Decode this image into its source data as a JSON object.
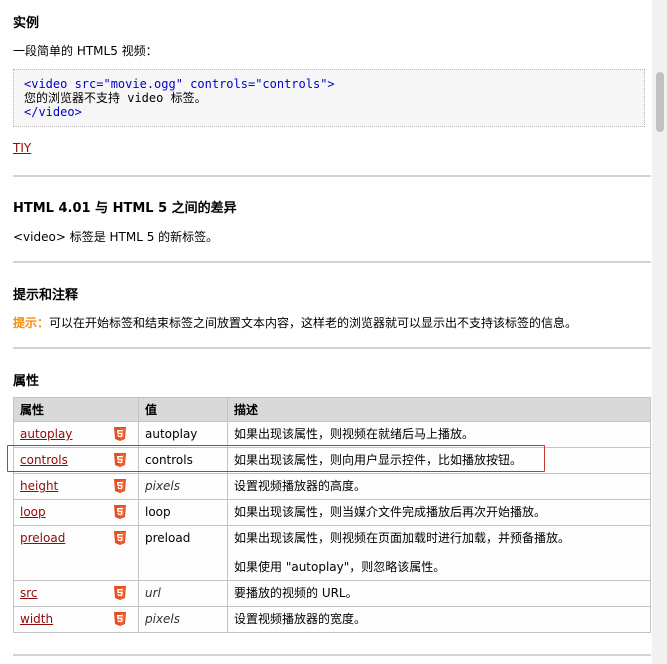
{
  "example": {
    "heading": "实例",
    "intro": "一段简单的 HTML5 视频：",
    "code": {
      "line1": "<video src=\"movie.ogg\" controls=\"controls\">",
      "line2": "您的浏览器不支持 video 标签。",
      "line3": "</video>"
    },
    "tiy_link": "TIY"
  },
  "diff": {
    "heading": "HTML 4.01 与 HTML 5 之间的差异",
    "text": "<video> 标签是 HTML 5 的新标签。"
  },
  "tips": {
    "heading": "提示和注释",
    "label": "提示：",
    "text": "可以在开始标签和结束标签之间放置文本内容，这样老的浏览器就可以显示出不支持该标签的信息。"
  },
  "attributes": {
    "heading": "属性",
    "columns": [
      "属性",
      "值",
      "描述"
    ],
    "rows": [
      {
        "name": "autoplay",
        "value": "autoplay",
        "value_italic": false,
        "desc": "如果出现该属性，则视频在就绪后马上播放。"
      },
      {
        "name": "controls",
        "value": "controls",
        "value_italic": false,
        "desc": "如果出现该属性，则向用户显示控件，比如播放按钮。"
      },
      {
        "name": "height",
        "value": "pixels",
        "value_italic": true,
        "desc": "设置视频播放器的高度。"
      },
      {
        "name": "loop",
        "value": "loop",
        "value_italic": false,
        "desc": "如果出现该属性，则当媒介文件完成播放后再次开始播放。"
      },
      {
        "name": "preload",
        "value": "preload",
        "value_italic": false,
        "desc": "如果出现该属性，则视频在页面加载时进行加载，并预备播放。",
        "desc2": "如果使用 \"autoplay\"，则忽略该属性。"
      },
      {
        "name": "src",
        "value": "url",
        "value_italic": true,
        "desc": "要播放的视频的 URL。"
      },
      {
        "name": "width",
        "value": "pixels",
        "value_italic": true,
        "desc": "设置视频播放器的宽度。"
      }
    ],
    "badge_icon": "html5-icon",
    "badge_color": "#e44d26"
  },
  "colors": {
    "link": "#900b09",
    "tip_label": "#ff8c00",
    "highlight_border": "#c0392b"
  }
}
